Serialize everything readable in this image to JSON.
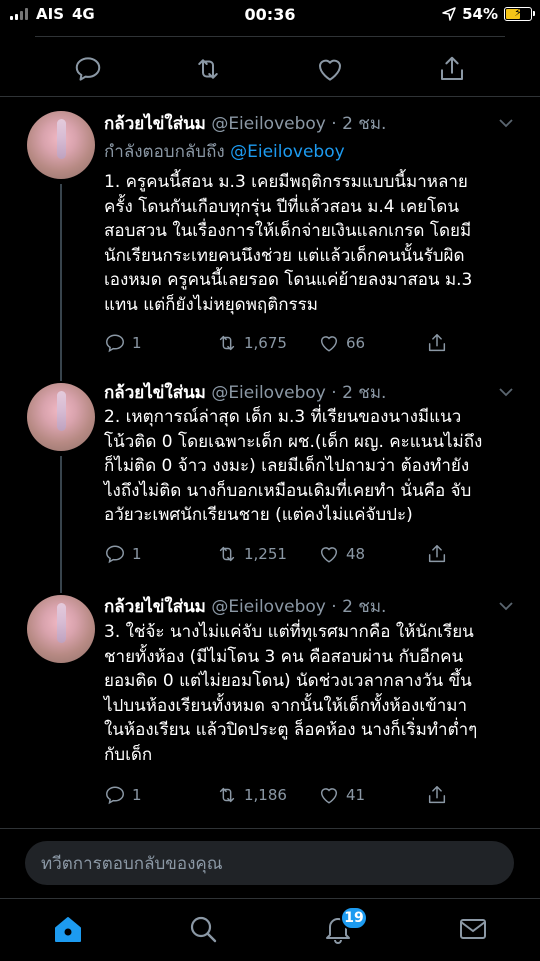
{
  "status_bar": {
    "carrier": "AIS",
    "network": "4G",
    "time": "00:36",
    "battery_percent": "54%",
    "battery_level": 0.54
  },
  "composer": {
    "placeholder": "ทวีตการตอบกลับของคุณ"
  },
  "tab_bar": {
    "notifications_badge": "19"
  },
  "colors": {
    "background": "#000000",
    "accent": "#1d9bf0",
    "secondary_text": "#8b98a5",
    "battery": "#f5c518"
  },
  "replies": [
    {
      "name": "กล้วยไข่ใส่นม",
      "handle": "@Eieiloveboy",
      "time": "· 2 ชม.",
      "replying_label": "กำลังตอบกลับถึง",
      "replying_to": "@Eieiloveboy",
      "text": "1. ครูคนนี้สอน ม.3  เคยมีพฤติกรรมแบบนี้มาหลาย\nครั้ง โดนกันเกือบทุกรุ่น ปีที่แล้วสอน ม.4 เคยโดน\nสอบสวน ในเรื่องการให้เด็กจ่ายเงินแลกเกรด โดยมี\nนักเรียนกระเทยคนนึงช่วย แต่แล้วเด็กคนนั้นรับผิด\nเองหมด ครูคนนี้เลยรอด  โดนแค่ย้ายลงมาสอน ม.3\nแทน แต่ก็ยังไม่หยุดพฤติกรรม",
      "replies": "1",
      "retweets": "1,675",
      "likes": "66"
    },
    {
      "name": "กล้วยไข่ใส่นม",
      "handle": "@Eieiloveboy",
      "time": "· 2 ชม.",
      "text": "2. เหตุการณ์ล่าสุด เด็ก ม.3 ที่เรียนของนางมีแนว\nโน้วติด 0 โดยเฉพาะเด็ก ผช.(เด็ก ผญ. คะแนนไม่ถึง\nก็ไม่ติด 0 จ้าว งงมะ) เลยมีเด็กไปถามว่า ต้องทำยัง\nไงถึงไม่ติด นางก็บอกเหมือนเดิมที่เคยทำ นั่นคือ จับ\nอวัยวะเพศนักเรียนชาย (แต่คงไม่แค่จับปะ)",
      "replies": "1",
      "retweets": "1,251",
      "likes": "48"
    },
    {
      "name": "กล้วยไข่ใส่นม",
      "handle": "@Eieiloveboy",
      "time": "· 2 ชม.",
      "text": "3. ใช่จ้ะ นางไม่แค่จับ แต่ที่ทุเรศมากคือ  ให้นักเรียน\nชายทั้งห้อง (มีไม่โดน 3 คน คือสอบผ่าน กับอีกคน\nยอมติด 0 แต่ไม่ยอมโดน) นัดช่วงเวลากลางวัน ขึ้น\nไปบนห้องเรียนทั้งหมด จากนั้นให้เด็กทั้งห้องเข้ามา\nในห้องเรียน แล้วปิดประตู ล็อคห้อง นางก็เริ่มทำต่ำๆ\nกับเด็ก",
      "replies": "1",
      "retweets": "1,186",
      "likes": "41"
    }
  ]
}
